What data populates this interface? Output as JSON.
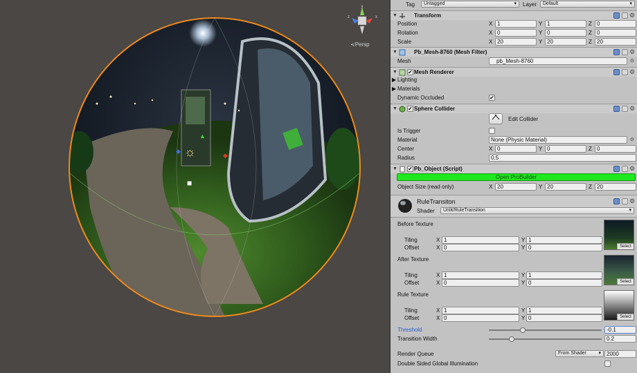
{
  "scene": {
    "persp_label": "≺Persp",
    "gizmo": {
      "y_label": "y",
      "x_label": "x",
      "z_label": "z"
    }
  },
  "inspector": {
    "tag_label": "Tag",
    "tag_value": "Untagged",
    "layer_label": "Layer",
    "layer_value": "Default",
    "transform": {
      "title": "Transform",
      "position_label": "Position",
      "rotation_label": "Rotation",
      "scale_label": "Scale",
      "position": {
        "x": "1",
        "y": "1",
        "z": "0"
      },
      "rotation": {
        "x": "0",
        "y": "0",
        "z": "0"
      },
      "scale": {
        "x": "20",
        "y": "20",
        "z": "20"
      }
    },
    "mesh_filter": {
      "title": "Pb_Mesh-8760 (Mesh Filter)",
      "mesh_label": "Mesh",
      "mesh_value": "pb_Mesh-8760"
    },
    "mesh_renderer": {
      "title": "Mesh Renderer",
      "lighting_label": "Lighting",
      "materials_label": "Materials",
      "dynamic_occluded_label": "Dynamic Occluded",
      "dynamic_occluded_checked": "✔"
    },
    "sphere_collider": {
      "title": "Sphere Collider",
      "edit_collider_label": "Edit Collider",
      "is_trigger_label": "Is Trigger",
      "material_label": "Material",
      "material_value": "None (Physic Material)",
      "center_label": "Center",
      "center": {
        "x": "0",
        "y": "0",
        "z": "0"
      },
      "radius_label": "Radius",
      "radius_value": "0.5"
    },
    "pb_object": {
      "title": "Pb_Object (Script)",
      "open_probuilder_label": "Open ProBuilder",
      "object_size_label": "Object Size (read only)",
      "object_size": {
        "x": "20",
        "y": "20",
        "z": "20"
      }
    },
    "material": {
      "title": "RuleTransiton",
      "shader_label": "Shader",
      "shader_value": "Unlit/RuleTransition",
      "before_texture_label": "Before Texture",
      "after_texture_label": "After Texture",
      "rule_texture_label": "Rule Texture",
      "tiling_label": "Tiling",
      "offset_label": "Offset",
      "select_label": "Select",
      "before": {
        "tiling_x": "1",
        "tiling_y": "1",
        "offset_x": "0",
        "offset_y": "0"
      },
      "after": {
        "tiling_x": "1",
        "tiling_y": "1",
        "offset_x": "0",
        "offset_y": "0"
      },
      "rule": {
        "tiling_x": "1",
        "tiling_y": "1",
        "offset_x": "0",
        "offset_y": "0"
      },
      "threshold_label": "Threshold",
      "threshold_value": "-0.1",
      "threshold_fraction": 0.3,
      "transition_width_label": "Transition Width",
      "transition_width_value": "0.2",
      "transition_width_fraction": 0.2,
      "render_queue_label": "Render Queue",
      "render_queue_mode": "From Shader",
      "render_queue_value": "2000",
      "double_sided_label": "Double Sided Global Illumination"
    },
    "axis": {
      "x": "X",
      "y": "Y",
      "z": "Z"
    }
  },
  "colors": {
    "scene_bg": "#4a4744",
    "inspector_bg": "#c2c2c2",
    "selection_outline": "#f08a1c",
    "probuilder_green": "#1ee81e",
    "threshold_label": "#2a5ec6"
  }
}
